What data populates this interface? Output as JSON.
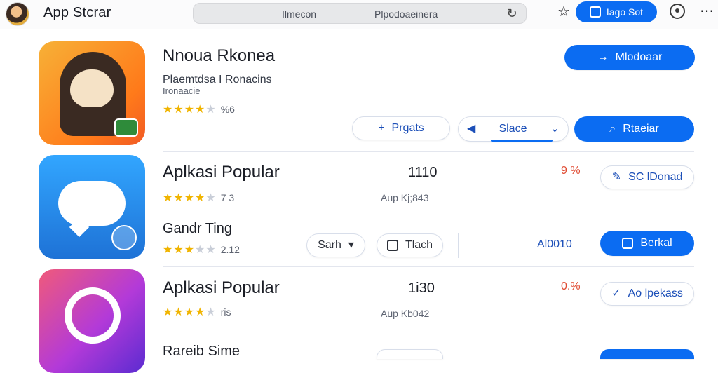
{
  "header": {
    "title": "App Stcrar",
    "address_left": "Ilmecon",
    "address_text": "Plpodoaeinera",
    "top_button_label": "Iago Sot"
  },
  "apps": [
    {
      "title": "Nnoua Rkonea",
      "subtitle": "Plaemtdsa I Ronacins",
      "small_note": "Ironaacie",
      "rating_text": "%6",
      "primary_label": "Mlodoaar",
      "outline_label": "Prgats",
      "segment_label": "Slace",
      "search_label": "Rtaeiar"
    },
    {
      "title": "Aplkasi Popular",
      "rating_text": "7 3",
      "count": "1110",
      "meta": "Aup Kj;843",
      "percent": "9 %",
      "outline_label": "SC lDonad",
      "second_title": "Gandr Ting",
      "second_rating_text": "2.12",
      "sort_label": "Sarh",
      "trash_label": "Tlach",
      "blue_text": "Al0010",
      "primary_label": "Berkal"
    },
    {
      "title": "Aplkasi Popular",
      "rating_text": "ris",
      "count": "1i30",
      "meta": "Aup Kb042",
      "percent": "0.%",
      "outline_label": "Ao lpekass",
      "partial_title": "Rareib Sime"
    }
  ],
  "colors": {
    "primary": "#0b6cf2",
    "star": "#f0b400",
    "warning": "#e04a31"
  }
}
